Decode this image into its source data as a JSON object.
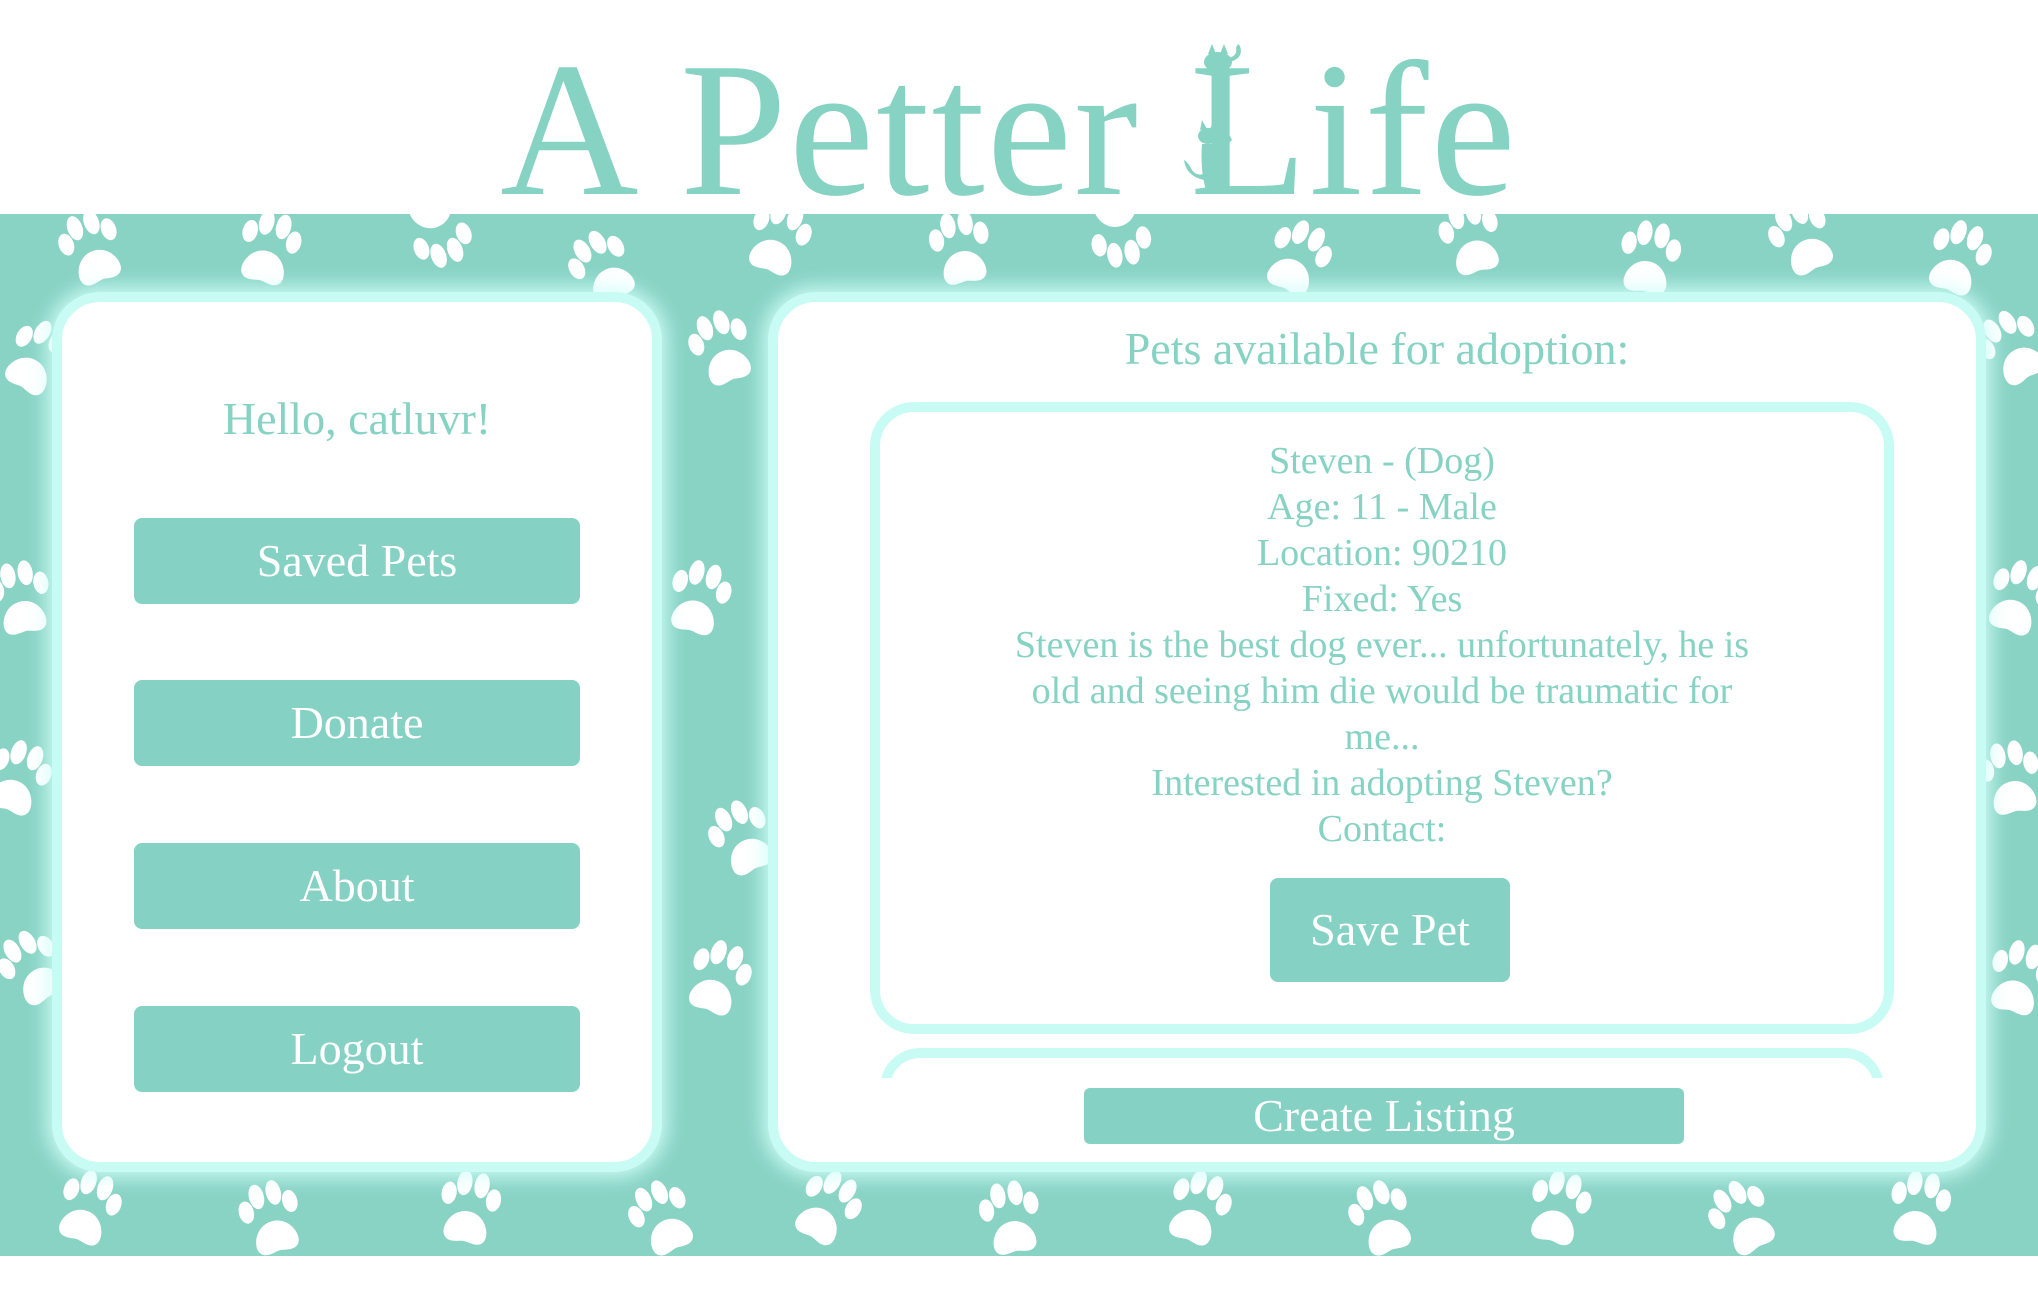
{
  "app": {
    "logo_text": "A Petter Life"
  },
  "colors": {
    "accent": "#86d2c3",
    "band": "#89d3c5",
    "panel_border": "#c9fbf5",
    "button": "#85d1c3"
  },
  "sidebar": {
    "greeting": "Hello, catluvr!",
    "buttons": [
      {
        "label": "Saved Pets",
        "icon": ""
      },
      {
        "label": "Donate",
        "icon": ""
      },
      {
        "label": "About",
        "icon": ""
      },
      {
        "label": "Logout",
        "icon": ""
      }
    ]
  },
  "main": {
    "heading": "Pets available for adoption:",
    "pet": {
      "name_line": "Steven - (Dog)",
      "age_line": "Age: 11 - Male",
      "location_line": "Location: 90210",
      "fixed_line": "Fixed: Yes",
      "description": "Steven is the best dog ever... unfortunately, he is old and seeing him die would be traumatic for me...",
      "interest_line": "Interested in adopting Steven?",
      "contact_line": "Contact:",
      "save_label": "Save Pet"
    },
    "create_label": "Create Listing"
  },
  "icons": {
    "logo_decoration": "cats-climbing-icon",
    "background_pattern": "paw-print-icon"
  }
}
